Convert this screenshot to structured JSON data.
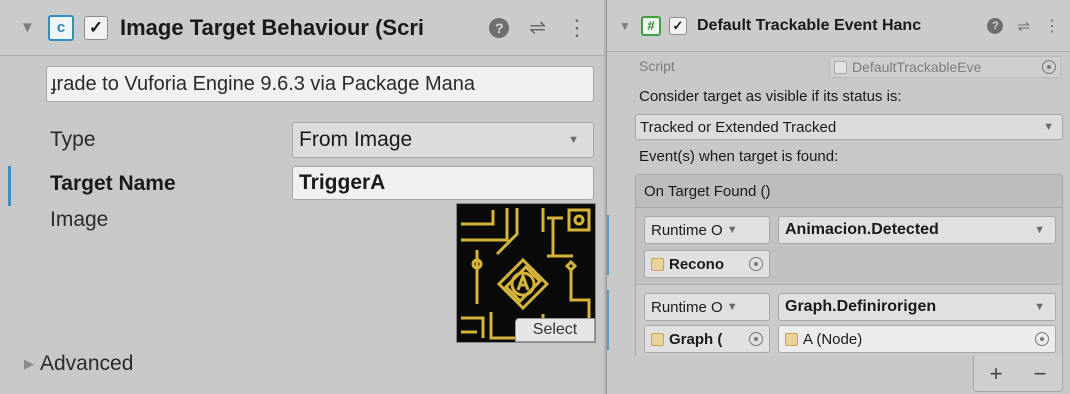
{
  "left": {
    "header": {
      "fold_glyph": "▼",
      "checkbox": "✓",
      "script_glyph": "c",
      "title": "Image Target Behaviour (Scri",
      "help_glyph": "?",
      "settings_glyph": "⇌",
      "menu_glyph": "⋮"
    },
    "upgrade_text": "ɟrade to Vuforia Engine 9.6.3 via Package Mana",
    "type_label": "Type",
    "type_value": "From Image",
    "target_name_label": "Target Name",
    "target_name_value": "TriggerA",
    "image_label": "Image",
    "select_label": "Select",
    "advanced_label": "Advanced",
    "advanced_glyph": "▶"
  },
  "right": {
    "header": {
      "fold_glyph": "▼",
      "checkbox": "✓",
      "script_glyph": "#",
      "title": "Default Trackable Event Hanc",
      "help_glyph": "?",
      "settings_glyph": "⇌",
      "menu_glyph": "⋮"
    },
    "script_label": "Script",
    "script_value": "DefaultTrackableEve",
    "consider_label": "Consider target as visible if its status is:",
    "status_value": "Tracked or Extended Tracked",
    "events_label": "Event(s) when target is found:",
    "event_header": "On Target Found ()",
    "events": [
      {
        "runtime": "Runtime O",
        "function": "Animacion.Detected",
        "object": "Recono",
        "arg": ""
      },
      {
        "runtime": "Runtime O",
        "function": "Graph.Definirorigen",
        "object": "Graph (",
        "arg": "A (Node)"
      }
    ],
    "add_label": "+",
    "remove_label": "−"
  },
  "colors": {
    "background": "#c8c8c8",
    "accent": "#3c8fc4",
    "script_icon": "#2f8fbf"
  }
}
